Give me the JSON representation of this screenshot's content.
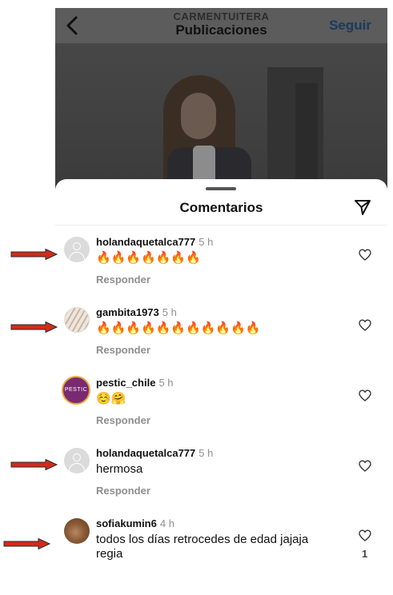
{
  "header": {
    "subtitle": "CARMENTUITERA",
    "title": "Publicaciones",
    "follow_label": "Seguir"
  },
  "sheet": {
    "title": "Comentarios"
  },
  "comments": [
    {
      "username": "holandaquetalca777",
      "time": "5 h",
      "text": "🔥🔥🔥🔥🔥🔥🔥",
      "reply_label": "Responder"
    },
    {
      "username": "gambita1973",
      "time": "5 h",
      "text": "🔥🔥🔥🔥🔥🔥🔥🔥🔥🔥🔥",
      "reply_label": "Responder"
    },
    {
      "username": "pestic_chile",
      "time": "5 h",
      "text": "☺️🤗",
      "reply_label": "Responder",
      "avatar_text": "PESTIC"
    },
    {
      "username": "holandaquetalca777",
      "time": "5 h",
      "text": "hermosa",
      "reply_label": "Responder"
    },
    {
      "username": "sofiakumin6",
      "time": "4 h",
      "text": "todos los días retrocedes de edad jajaja regia",
      "like_count": "1"
    }
  ],
  "icons": {
    "back": "chevron-left-icon",
    "send": "send-icon",
    "heart": "heart-outline-icon",
    "arrow": "red-arrow-annotation"
  },
  "colors": {
    "follow": "#1b3a63",
    "arrow": "#d42a1a"
  }
}
